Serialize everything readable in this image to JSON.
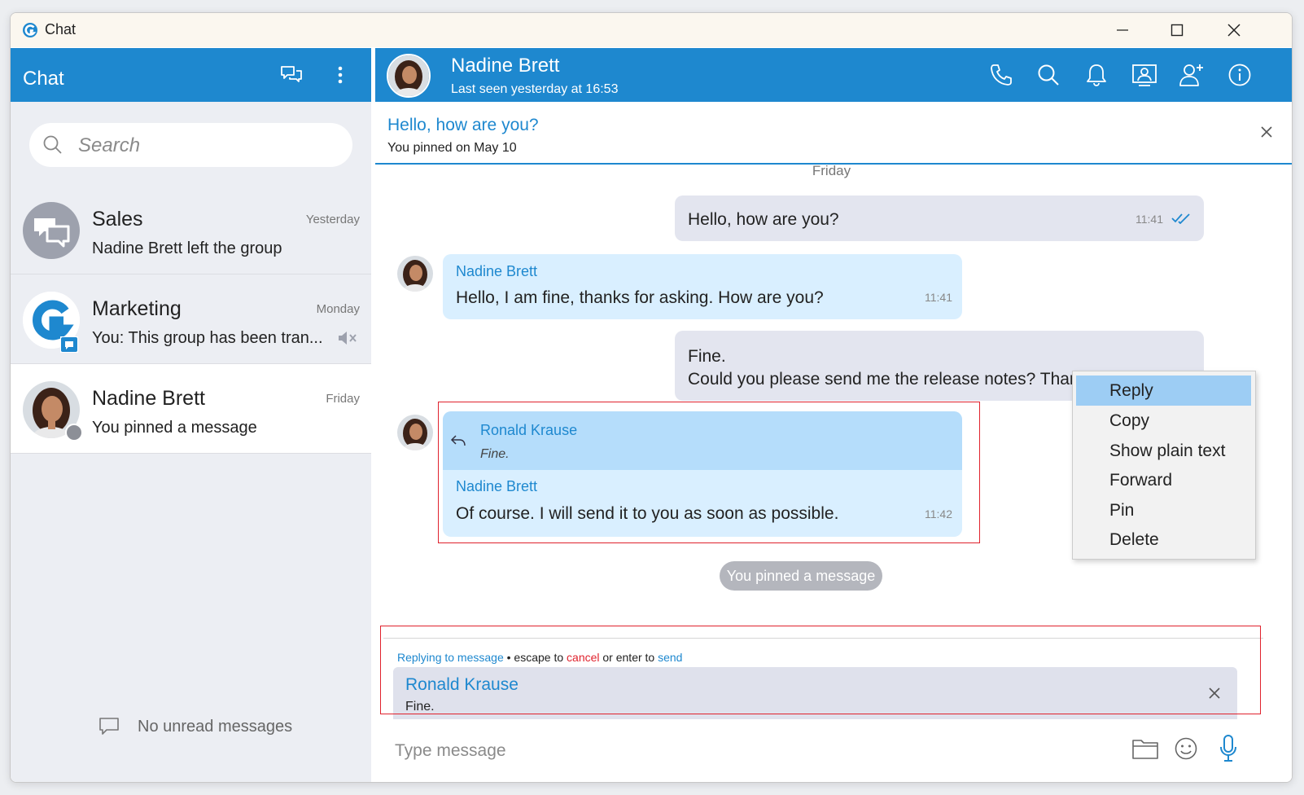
{
  "window": {
    "title": "Chat"
  },
  "sidebar": {
    "title": "Chat",
    "search_placeholder": "Search",
    "conversations": [
      {
        "name": "Sales",
        "preview": "Nadine Brett left the group",
        "date": "Yesterday"
      },
      {
        "name": "Marketing",
        "preview": "You: This group has been tran...",
        "date": "Monday",
        "muted": true
      },
      {
        "name": "Nadine Brett",
        "preview": "You pinned a message",
        "date": "Friday",
        "selected": true
      }
    ],
    "footer": "No unread messages"
  },
  "chat": {
    "contact_name": "Nadine Brett",
    "status": "Last seen yesterday at 16:53",
    "pinned": {
      "text": "Hello, how are you?",
      "note": "You pinned on May 10"
    },
    "day_label": "Friday",
    "messages": [
      {
        "text": "Hello, how are you?",
        "time": "11:41"
      },
      {
        "sender": "Nadine Brett",
        "text": "Hello, I am fine, thanks for asking. How are you?",
        "time": "11:41"
      },
      {
        "line1": "Fine.",
        "line2": "Could you please send me the release notes? Thanks."
      },
      {
        "quote_sender": "Ronald Krause",
        "quote_text": "Fine.",
        "sender": "Nadine Brett",
        "text": "Of course. I will send it to you as soon as possible.",
        "time": "11:42"
      }
    ],
    "system_message": "You pinned a message",
    "context_menu": [
      "Reply",
      "Copy",
      "Show plain text",
      "Forward",
      "Pin",
      "Delete"
    ],
    "reply_hint": {
      "part1": "Replying to message",
      "part2": " • escape to ",
      "cancel": "cancel",
      "part3": " or enter to ",
      "send": "send"
    },
    "reply_preview": {
      "sender": "Ronald Krause",
      "text": "Fine."
    },
    "composer_placeholder": "Type message"
  },
  "colors": {
    "accent": "#1e88cf",
    "outgoing_bubble": "#e3e5ef",
    "incoming_bubble": "#d9efff",
    "highlight_border": "#e0222d"
  }
}
